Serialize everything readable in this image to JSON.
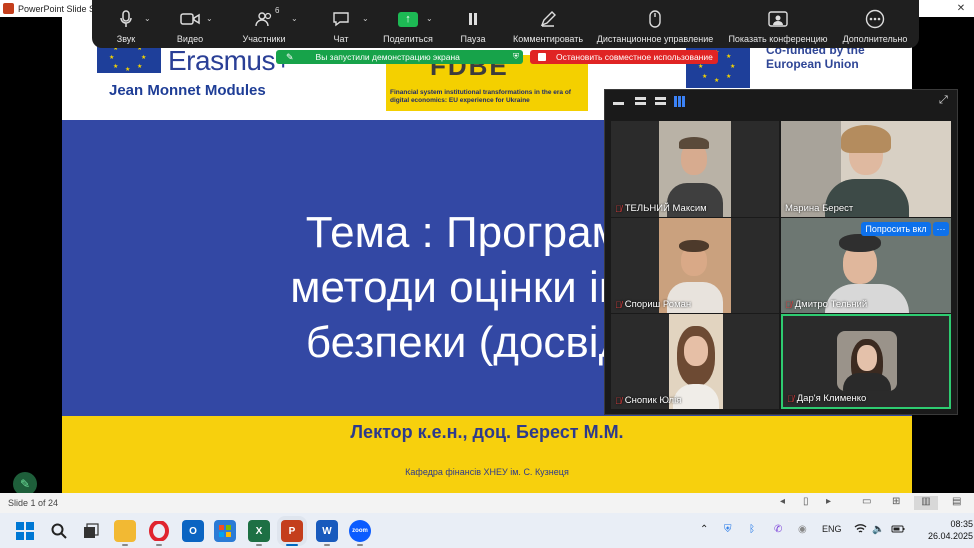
{
  "window": {
    "title": "PowerPoint Slide S",
    "close_icon": "close-icon"
  },
  "slide": {
    "header": {
      "erasmus": "Erasmus+",
      "jean_monnet": "Jean Monnet Modules",
      "project_logo_text": "FDBE",
      "project_desc": "Financial system institutional transformations in the era of digital economics: EU experience for Ukraine",
      "cofunded_line1": "Co-funded by the",
      "cofunded_line2": "European Union"
    },
    "theme_line1": "Тема : Програмні з",
    "theme_line2": "методи оцінки інфо",
    "theme_line3": "безпеки (досвід Є",
    "lecturer": "Лектор к.е.н., доц. Берест М.М.",
    "department": "Кафедра фінансів ХНЕУ ім. С. Кузнеця"
  },
  "zoom_toolbar": {
    "audio": "Звук",
    "video": "Видео",
    "participants": "Участники",
    "participants_count": "6",
    "chat": "Чат",
    "share": "Поделиться",
    "pause": "Пауза",
    "annotate": "Комментировать",
    "remote_control": "Дистанционное управление",
    "show_conference": "Показать конференцию",
    "more": "Дополнительно"
  },
  "banners": {
    "sharing": "Вы запустили демонстрацию экрана",
    "stop_sharing": "Остановить совместное использование"
  },
  "participants": [
    {
      "name": "ТЕЛЬНИЙ Максим",
      "muted": true
    },
    {
      "name": "Марина Берест",
      "muted": false
    },
    {
      "name": "Спориш Роман",
      "muted": true
    },
    {
      "name": "Дмитро Тельний",
      "muted": true
    },
    {
      "name": "Снопик Юлія",
      "muted": true
    },
    {
      "name": "Дар'я Клименко",
      "muted": true
    }
  ],
  "ask_unmute": "Попросить вкл",
  "more_dots": "···",
  "statusbar": {
    "slide_indicator": "Slide 1 of 24"
  },
  "taskbar": {
    "language": "ENG",
    "time": "08:35",
    "date": "26.04.2025",
    "zoom_label": "zoom",
    "apps": [
      "start",
      "search",
      "task-view",
      "file-explorer",
      "opera",
      "outlook",
      "store",
      "excel",
      "powerpoint",
      "word",
      "zoom"
    ]
  },
  "colors": {
    "slide_blue": "#3348a4",
    "slide_yellow": "#f7d00d",
    "zoom_green": "#17a34a",
    "zoom_red": "#e02424",
    "active_speaker_border": "#2ecc71",
    "ask_button_blue": "#0e71eb"
  }
}
